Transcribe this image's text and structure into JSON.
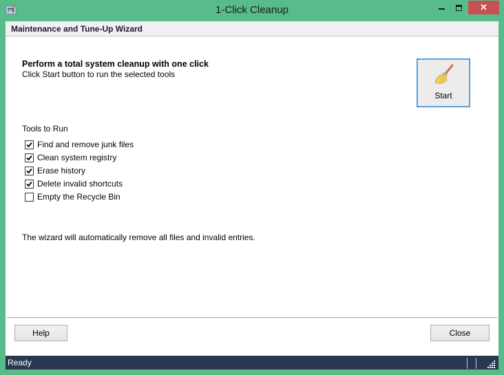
{
  "window": {
    "title": "1-Click Cleanup",
    "controls": {
      "minimize": "minimize",
      "maximize": "maximize",
      "close": "✕"
    }
  },
  "header": {
    "title": "Maintenance and Tune-Up Wizard"
  },
  "intro": {
    "headline": "Perform a total system cleanup with one click",
    "subline": "Click Start button to run the selected tools"
  },
  "start_button": {
    "label": "Start",
    "icon": "broom-icon"
  },
  "tools": {
    "label": "Tools to Run",
    "items": [
      {
        "label": "Find and remove junk files",
        "checked": true
      },
      {
        "label": "Clean system registry",
        "checked": true
      },
      {
        "label": "Erase history",
        "checked": true
      },
      {
        "label": "Delete invalid shortcuts",
        "checked": true
      },
      {
        "label": "Empty the Recycle Bin",
        "checked": false
      }
    ]
  },
  "info": "The wizard will automatically remove all files and invalid entries.",
  "buttons": {
    "help": "Help",
    "close": "Close"
  },
  "status": {
    "text": "Ready"
  },
  "colors": {
    "frame": "#58bb8a",
    "close_button": "#c75050",
    "statusbar": "#283850",
    "header_band": "#f0f0f5"
  }
}
